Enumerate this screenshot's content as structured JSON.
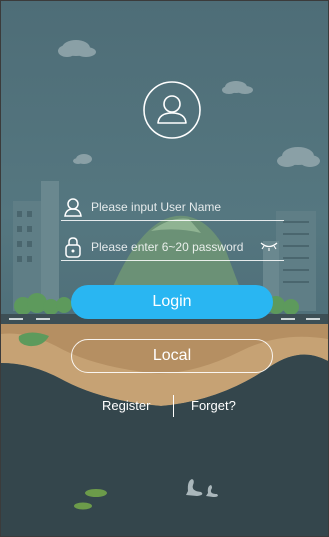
{
  "login_form": {
    "username_placeholder": "Please input User Name",
    "password_placeholder": "Please enter 6~20 password",
    "login_label": "Login",
    "local_label": "Local"
  },
  "links": {
    "register": "Register",
    "forget": "Forget?"
  },
  "colors": {
    "accent": "#29b6f2",
    "background_top": "#4e6d77",
    "background_bottom": "#2f3f45",
    "text": "#ffffff"
  },
  "icons": [
    "avatar-icon",
    "user-icon",
    "lock-icon",
    "eye-closed-icon"
  ]
}
